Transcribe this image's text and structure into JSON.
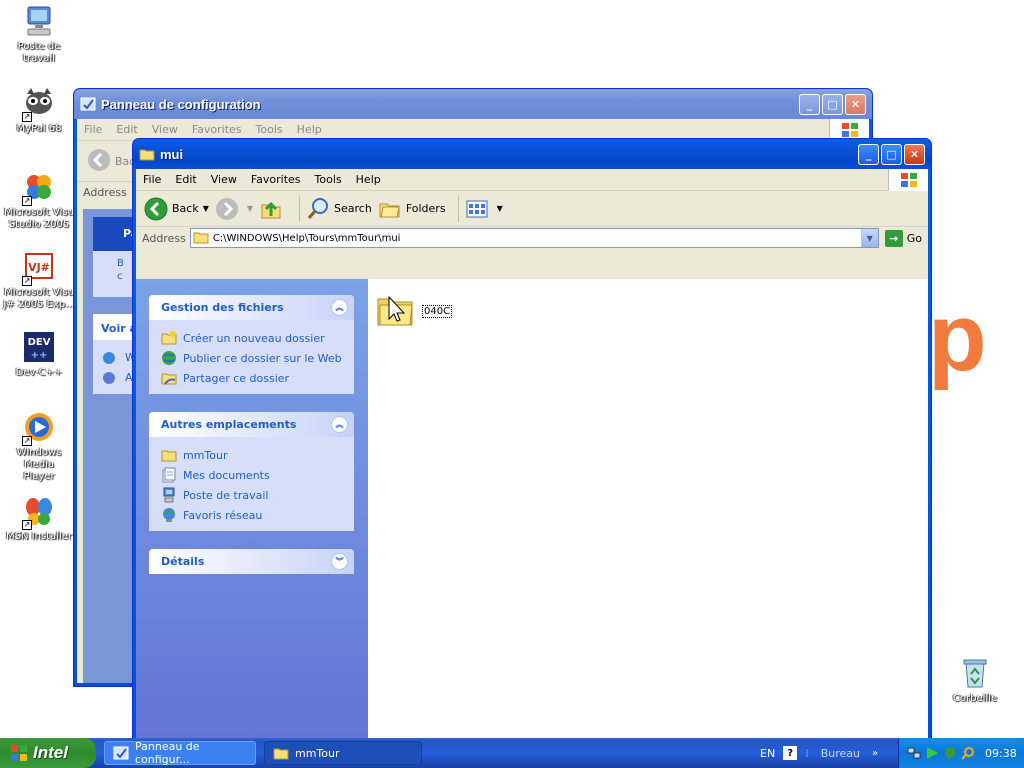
{
  "desktop": {
    "icons": [
      {
        "label": "Poste de\ntravail",
        "icon": "computer-icon"
      },
      {
        "label": "MyPal 68",
        "icon": "raccoon-icon"
      },
      {
        "label": "Microsoft Visu\nStudio 2005",
        "icon": "visual-studio-icon"
      },
      {
        "label": "Microsoft Visu\nJ# 2005 Exp...",
        "icon": "vj-sharp-icon"
      },
      {
        "label": "Dev-C++",
        "icon": "dev-cpp-icon"
      },
      {
        "label": "Windows Media\nPlayer",
        "icon": "media-player-icon"
      },
      {
        "label": "MSN Installer",
        "icon": "msn-butterfly-icon"
      },
      {
        "label": "Corbeille",
        "icon": "recycle-bin-icon"
      }
    ],
    "wallpaper_letter": "p"
  },
  "back_window": {
    "title": "Panneau de configuration",
    "menu": [
      "File",
      "Edit",
      "View",
      "Favorites",
      "Tools",
      "Help"
    ],
    "back_label": "Bac",
    "address_label": "Address",
    "panel_header": "Pa",
    "voir_label": "Voir a",
    "item_w": "W",
    "item_a": "A",
    "item_b": "B",
    "item_c": "c"
  },
  "front_window": {
    "title": "mui",
    "menu": [
      "File",
      "Edit",
      "View",
      "Favorites",
      "Tools",
      "Help"
    ],
    "toolbar": {
      "back": "Back",
      "search": "Search",
      "folders": "Folders"
    },
    "address_label": "Address",
    "address_value": "C:\\WINDOWS\\Help\\Tours\\mmTour\\mui",
    "go_label": "Go",
    "tasks": {
      "title": "Gestion des fichiers",
      "items": [
        "Créer un nouveau dossier",
        "Publier ce dossier sur le Web",
        "Partager ce dossier"
      ]
    },
    "places": {
      "title": "Autres emplacements",
      "items": [
        "mmTour",
        "Mes documents",
        "Poste de travail",
        "Favoris réseau"
      ]
    },
    "details": {
      "title": "Détails"
    },
    "files": [
      {
        "name": "040C",
        "type": "folder"
      }
    ]
  },
  "taskbar": {
    "start_label": "Intel",
    "tasks": [
      {
        "label": "Panneau de configur...",
        "active": false
      },
      {
        "label": "mmTour",
        "active": true
      }
    ],
    "language": "EN",
    "help_glyph": "?",
    "bureau_label": "Bureau",
    "chevron": "»",
    "clock": "09:38"
  },
  "colors": {
    "xp_blue": "#0a5ed8",
    "link_blue": "#215dc6",
    "taskbar_blue": "#245edb",
    "start_green": "#3c9a3c",
    "wallpaper_orange": "#f07b3f"
  }
}
